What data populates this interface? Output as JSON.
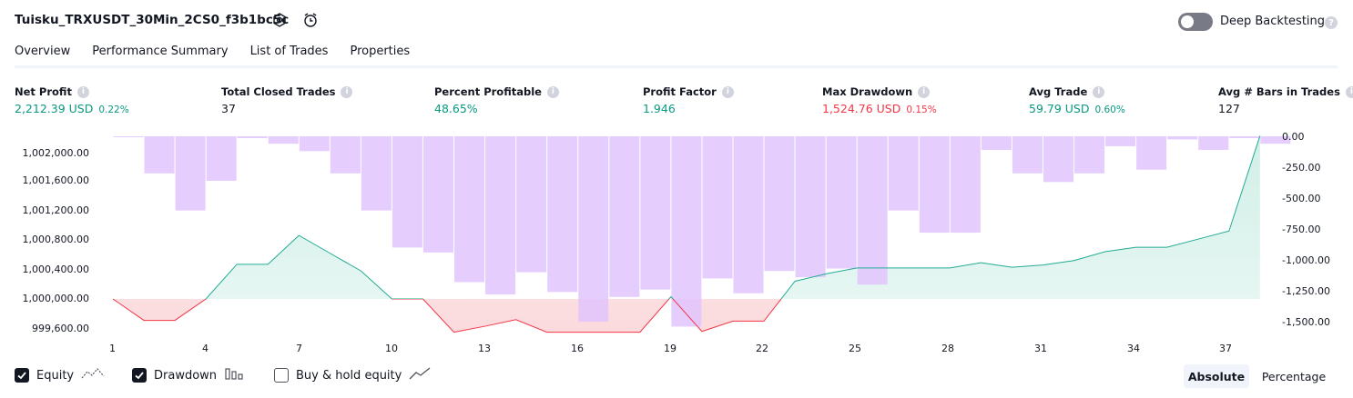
{
  "header": {
    "title": "Tuisku_TRXUSDT_30Min_2CS0_f3b1bc5c",
    "deep_backtesting_label": "Deep Backtesting",
    "deep_backtesting_enabled": false,
    "help_glyph": "?"
  },
  "tabs": [
    {
      "label": "Overview",
      "active": true
    },
    {
      "label": "Performance Summary",
      "active": false
    },
    {
      "label": "List of Trades",
      "active": false
    },
    {
      "label": "Properties",
      "active": false
    }
  ],
  "stats": {
    "net_profit": {
      "label": "Net Profit",
      "value": "2,212.39 USD",
      "pct": "0.22%"
    },
    "total_closed_trades": {
      "label": "Total Closed Trades",
      "value": "37"
    },
    "percent_profitable": {
      "label": "Percent Profitable",
      "value": "48.65%"
    },
    "profit_factor": {
      "label": "Profit Factor",
      "value": "1.946"
    },
    "max_drawdown": {
      "label": "Max Drawdown",
      "value": "1,524.76 USD",
      "pct": "0.15%"
    },
    "avg_trade": {
      "label": "Avg Trade",
      "value": "59.79 USD",
      "pct": "0.60%"
    },
    "avg_bars": {
      "label": "Avg # Bars in Trades",
      "value": "127"
    }
  },
  "legend": {
    "equity": {
      "label": "Equity",
      "checked": true
    },
    "drawdown": {
      "label": "Drawdown",
      "checked": true
    },
    "buy_hold": {
      "label": "Buy & hold equity",
      "checked": false
    }
  },
  "scale_toggle": {
    "absolute": "Absolute",
    "percentage": "Percentage",
    "selected": "Absolute"
  },
  "colors": {
    "equity_line": "#22ab94",
    "equity_fill": "#d1efe7",
    "loss_line": "#f23645",
    "loss_fill": "#fbdadd",
    "drawdown_bar": "#e1c4fd",
    "positive": "#089981",
    "negative": "#f23645"
  },
  "chart_data": {
    "type": "line",
    "x": [
      1,
      2,
      3,
      4,
      5,
      6,
      7,
      8,
      9,
      10,
      11,
      12,
      13,
      14,
      15,
      16,
      17,
      18,
      19,
      20,
      21,
      22,
      23,
      24,
      25,
      26,
      27,
      28,
      29,
      30,
      31,
      32,
      33,
      34,
      35,
      36,
      37,
      38
    ],
    "equity": [
      1000000,
      999710,
      999710,
      1000000,
      1000470,
      1000470,
      1000860,
      1000620,
      1000380,
      1000000,
      1000000,
      999550,
      999630,
      999720,
      999550,
      999550,
      999550,
      999550,
      1000030,
      999560,
      999700,
      999700,
      1000240,
      1000340,
      1000420,
      1000420,
      1000420,
      1000420,
      1000490,
      1000430,
      1000460,
      1000520,
      1000640,
      1000700,
      1000700,
      1000810,
      1000920,
      1002210
    ],
    "baseline": 1000000,
    "drawdown": [
      -5,
      -300,
      -600,
      -360,
      -15,
      -60,
      -120,
      -300,
      -600,
      -900,
      -940,
      -1180,
      -1280,
      -1100,
      -1260,
      -1500,
      -1300,
      -1240,
      -1540,
      -1150,
      -1270,
      -1090,
      -1140,
      -1070,
      -1200,
      -600,
      -780,
      -780,
      -110,
      -300,
      -370,
      -300,
      -80,
      -270,
      -25,
      -110,
      -15,
      -60
    ],
    "x_ticks": [
      "1",
      "4",
      "7",
      "10",
      "13",
      "16",
      "19",
      "22",
      "25",
      "28",
      "31",
      "34",
      "37"
    ],
    "y_left_ticks": [
      "1,002,000.00",
      "1,001,600.00",
      "1,001,200.00",
      "1,000,800.00",
      "1,000,400.00",
      "1,000,000.00",
      "999,600.00"
    ],
    "y_right_ticks": [
      "0.00",
      "-250.00",
      "-500.00",
      "-750.00",
      "-1,000.00",
      "-1,250.00",
      "-1,500.00"
    ],
    "y_left_range": [
      999500,
      1002200
    ],
    "y_right_range": [
      -1550,
      0
    ],
    "series": [
      {
        "name": "Equity"
      },
      {
        "name": "Drawdown"
      }
    ],
    "grid": false,
    "legend_position": "bottom-left"
  }
}
